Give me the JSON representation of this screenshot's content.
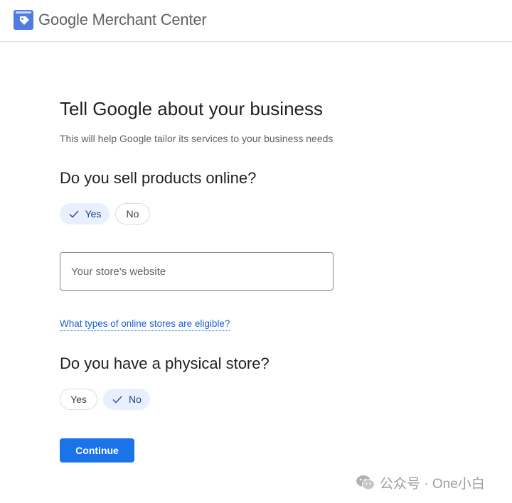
{
  "header": {
    "brand_google": "Google",
    "brand_product": "Merchant Center",
    "logo_icon": "merchant-tag-icon"
  },
  "main": {
    "title": "Tell Google about your business",
    "subtitle": "This will help Google tailor its services to your business needs",
    "online_question": "Do you sell products online?",
    "online_options": [
      {
        "label": "Yes",
        "selected": true
      },
      {
        "label": "No",
        "selected": false
      }
    ],
    "website_placeholder": "Your store's website",
    "website_value": "",
    "eligibility_link": "What types of online stores are eligible?",
    "physical_question": "Do you have a physical store?",
    "physical_options": [
      {
        "label": "Yes",
        "selected": false
      },
      {
        "label": "No",
        "selected": true
      }
    ],
    "continue_label": "Continue"
  },
  "watermark": {
    "text": "公众号 · One小白",
    "icon": "wechat-icon"
  },
  "colors": {
    "accent": "#1a73e8",
    "chip_selected_bg": "#e8f0fe"
  }
}
